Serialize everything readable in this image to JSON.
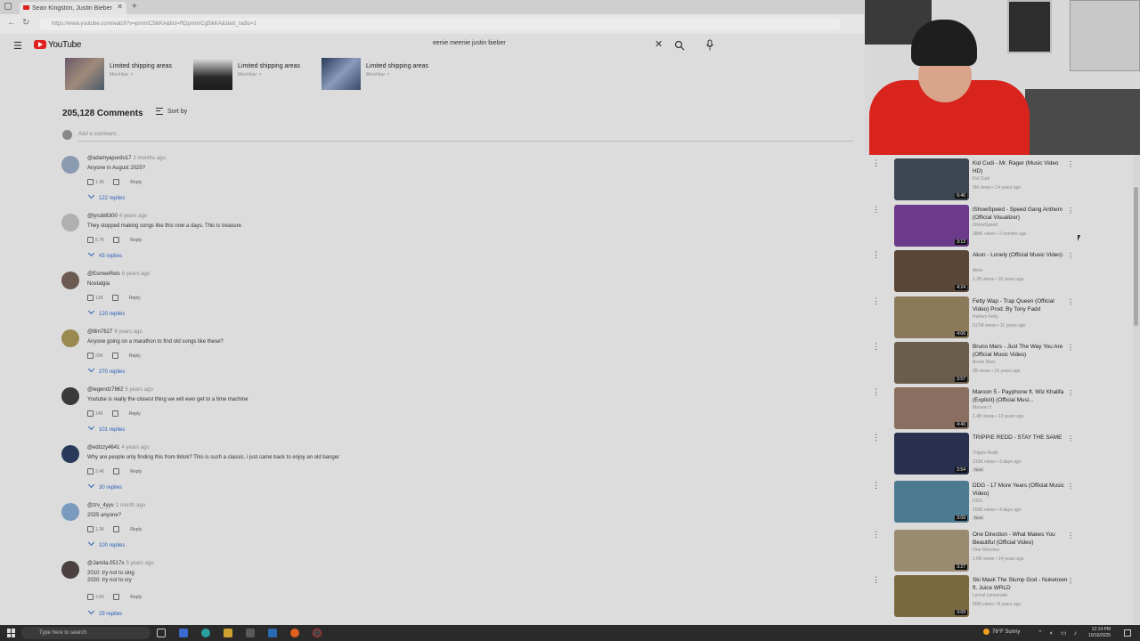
{
  "browser": {
    "tab_title": "Sean Kingston, Justin Bieber",
    "url": "https://www.youtube.com/watch?v=pmmIC5lkKA&list=RDpmmICg5lkKA&start_radio=1"
  },
  "youtube": {
    "logo_text": "YouTube",
    "search_query": "eenie meenie justin bieber"
  },
  "merch": [
    {
      "title": "Limited shipping areas",
      "source": "Merchbar ↗"
    },
    {
      "title": "Limited shipping areas",
      "source": "Merchbar ↗"
    },
    {
      "title": "Limited shipping areas",
      "source": "Merchbar ↗"
    }
  ],
  "comments_section": {
    "count": "205,128 Comments",
    "sort_label": "Sort by",
    "add_placeholder": "Add a comment...",
    "reply_label": "Reply"
  },
  "comments": [
    {
      "user": "@adamyapurdo17",
      "time": "2 months ago",
      "text": "Anyone in August 2025?",
      "likes": "1.3K",
      "replies": "122 replies"
    },
    {
      "user": "@lyrubi8300",
      "time": "4 years ago",
      "text": "They stopped making songs like this now a days. This is treasure",
      "likes": "5.7K",
      "replies": "43 replies"
    },
    {
      "user": "@EsmeeReis",
      "time": "6 years ago",
      "text": "Nostalgia",
      "likes": "12K",
      "replies": "120 replies"
    },
    {
      "user": "@lllm7627",
      "time": "6 years ago",
      "text": "Anyone going on a marathon to find old songs like these?",
      "likes": "20K",
      "replies": "270 replies"
    },
    {
      "user": "@legendz7862",
      "time": "5 years ago",
      "text": "Youtube is really the closest thing we will ever get to a time machine",
      "likes": "14K",
      "replies": "101 replies"
    },
    {
      "user": "@edizzy4641",
      "time": "4 years ago",
      "text": "Why are people only finding this from tiktok? This is such a classic, i just came back to enjoy an old banger",
      "likes": "2.4K",
      "replies": "30 replies"
    },
    {
      "user": "@zrv_4yyv",
      "time": "1 month ago",
      "text": "2025 anyone?",
      "likes": "1.3K",
      "replies": "100 replies"
    },
    {
      "user": "@Jamila.0517x",
      "time": "5 years ago",
      "text": "2010: try not to sing\n2020: try not to cry",
      "likes": "2.6K",
      "replies": "29 replies"
    }
  ],
  "recommendations": [
    {
      "title": "Kid Cudi - Mr. Rager (Music Video HD)",
      "channel": "Kid Cudi",
      "meta": "5M views • 14 years ago",
      "duration": "6:46",
      "color": "#3c4550",
      "new": ""
    },
    {
      "title": "iShowSpeed - Speed Gang Anthem (Official Visualizer)",
      "channel": "iShowSpeed",
      "meta": "388K views • 2 months ago",
      "duration": "3:13",
      "color": "#6b3a8a",
      "new": ""
    },
    {
      "title": "Akon - Lonely (Official Music Video)",
      "channel": "Akon",
      "meta": "1.2B views • 16 years ago",
      "duration": "4:24",
      "color": "#5a4636",
      "new": ""
    },
    {
      "title": "Fetty Wap - Trap Queen (Official Video) Prod. By Tony Fadd",
      "channel": "Harlem Fetty",
      "meta": "917M views • 11 years ago",
      "duration": "4:06",
      "color": "#8a7a5a",
      "new": ""
    },
    {
      "title": "Bruno Mars - Just The Way You Are (Official Music Video)",
      "channel": "Bruno Mars",
      "meta": "2B views • 15 years ago",
      "duration": "3:57",
      "color": "#6a5d4c",
      "new": ""
    },
    {
      "title": "Maroon 5 - Payphone ft. Wiz Khalifa (Explicit) (Official Musi...",
      "channel": "Maroon 5",
      "meta": "1.4B views • 13 years ago",
      "duration": "4:40",
      "color": "#8a6f60",
      "new": ""
    },
    {
      "title": "TRIPPIE REDD - STAY THE SAME",
      "channel": "Trippie Redd",
      "meta": "315K views • 3 days ago",
      "duration": "2:54",
      "color": "#2a3050",
      "new": "New"
    },
    {
      "title": "DDG - 17 More Years (Official Music Video)",
      "channel": "DDG",
      "meta": "209K views • 4 days ago",
      "duration": "3:09",
      "color": "#4c7a90",
      "new": "New"
    },
    {
      "title": "One Direction - What Makes You Beautiful (Official Video)",
      "channel": "One Direction",
      "meta": "1.6B views • 14 years ago",
      "duration": "3:27",
      "color": "#9a8a70",
      "new": ""
    },
    {
      "title": "Ski Mask The Slump God - Nuketown ft. Juice WRLD",
      "channel": "Lyrical Lemonade",
      "meta": "80M views • 8 years ago",
      "duration": "3:09",
      "color": "#7a6a40",
      "new": ""
    }
  ],
  "taskbar": {
    "search_placeholder": "Type here to search",
    "weather": "76°F  Sunny",
    "time": "12:14 PM",
    "date": "10/16/2025"
  },
  "colors": {
    "youtube_red": "#e02020",
    "link_blue": "#2a5fb8",
    "webcam_shirt": "#d8241c"
  }
}
